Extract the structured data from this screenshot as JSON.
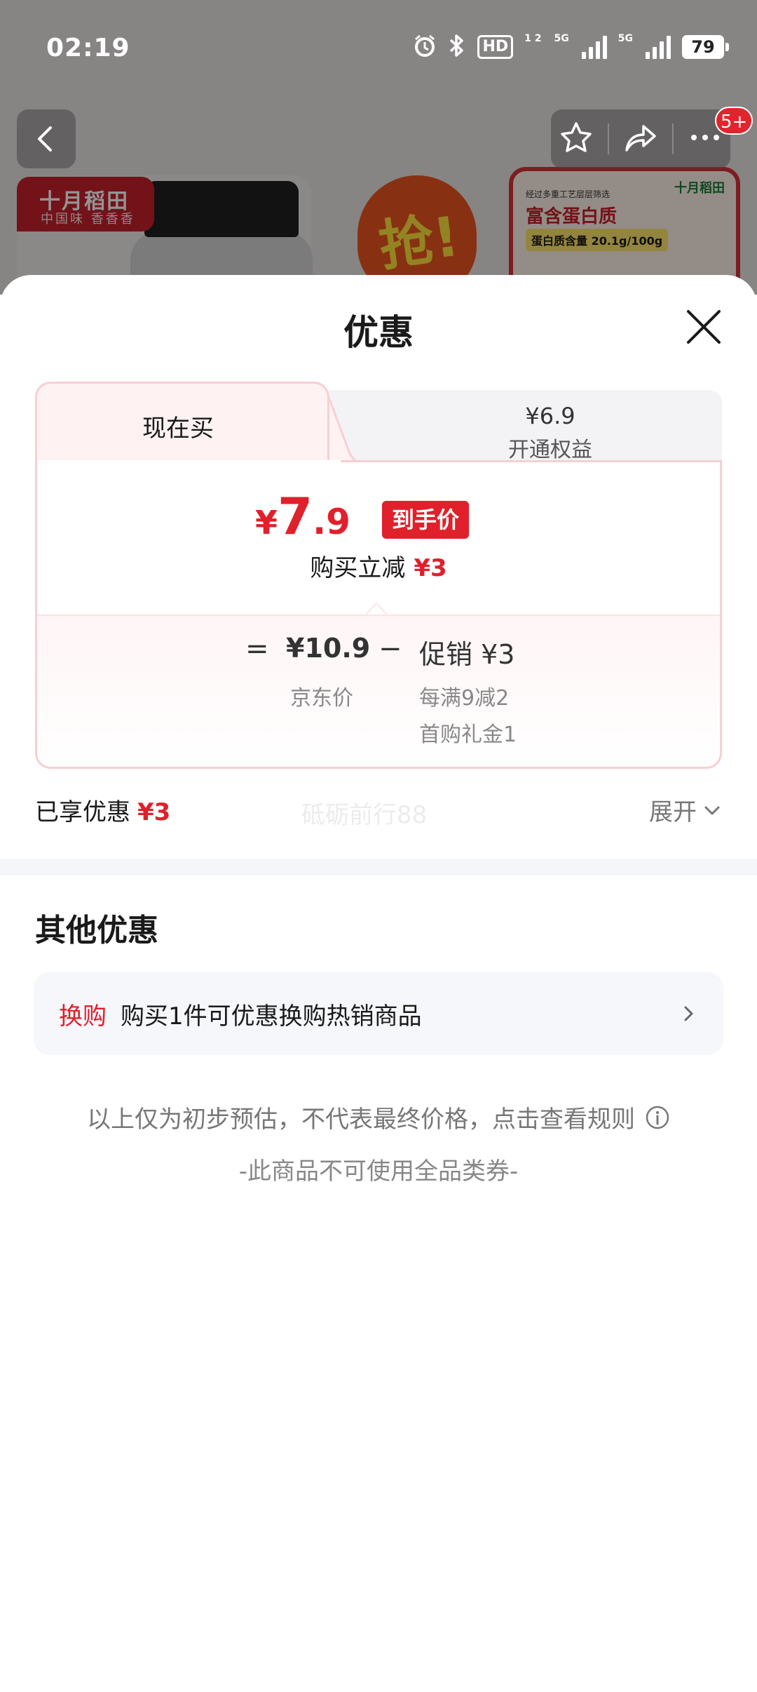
{
  "status_bar": {
    "time": "02:19",
    "hd_label": "HD",
    "hd_sub": "1 2",
    "net1": "5G",
    "net2": "5G",
    "battery": "79"
  },
  "background": {
    "brand_logo": "十月稻田",
    "brand_slogan": "中国味 香香香",
    "promo_flame_text": "抢!",
    "card_small_text": "经过多重工艺层层筛选",
    "card_headline": "富含蛋白质",
    "card_protein": "蛋白质含量 20.1g/100g",
    "card_logo": "十月稻田",
    "cart_badge": "5+"
  },
  "sheet": {
    "title": "优惠",
    "tabs": {
      "active_label": "现在买",
      "inactive_price": "¥6.9",
      "inactive_label": "开通权益"
    },
    "final_price": {
      "currency": "¥",
      "integer": "7",
      "decimal": ".9",
      "tag": "到手价"
    },
    "reduce": {
      "label": "购买立减",
      "amount": "¥3"
    },
    "calc": {
      "equals": "=",
      "base_price": "¥10.9",
      "base_label": "京东价",
      "minus": "−",
      "promo_label": "促销 ¥3",
      "promo_detail_1": "每满9减2",
      "promo_detail_2": "首购礼金1"
    },
    "enjoyed": {
      "label": "已享优惠",
      "amount": "¥3"
    },
    "watermark": "砥砺前行88",
    "expand_label": "展开",
    "other": {
      "title": "其他优惠",
      "exchange_tag": "换购",
      "exchange_desc": "购买1件可优惠换购热销商品"
    },
    "disclaimer": "以上仅为初步预估，不代表最终价格，点击查看规则",
    "note": "-此商品不可使用全品类券-"
  },
  "colors": {
    "accent_red": "#e0202b",
    "card_border": "#f7cfd4",
    "muted_text": "#888888"
  },
  "icons": [
    "back-icon",
    "star-icon",
    "share-icon",
    "more-icon",
    "close-icon",
    "chevron-down-icon",
    "chevron-right-icon",
    "info-icon",
    "alarm-icon",
    "bluetooth-icon"
  ]
}
